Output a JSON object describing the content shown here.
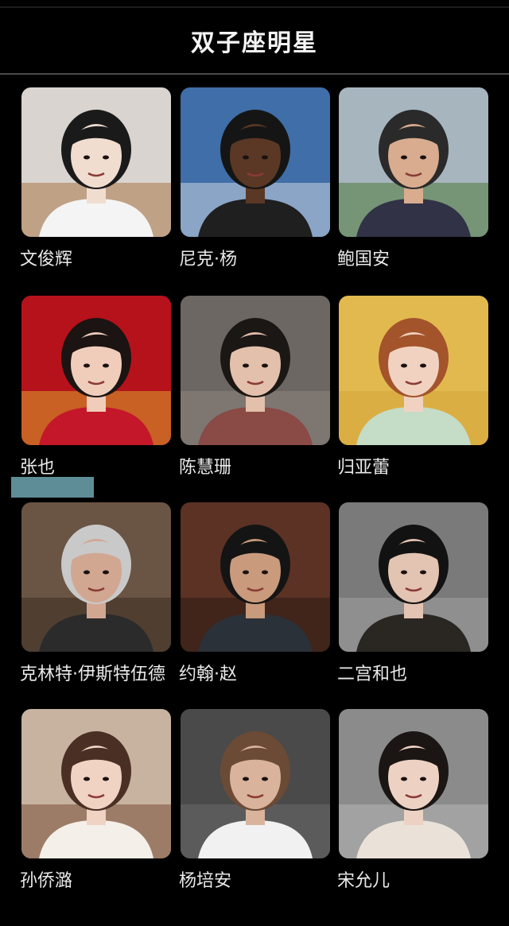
{
  "header": {
    "title": "双子座明星"
  },
  "celebrities": [
    {
      "name": "文俊辉",
      "bg": "#d9d4cf",
      "bg2": "#a9774a",
      "skin": "#f1ddd0",
      "hair": "#1a1a1a",
      "cloth": "#f4f4f4"
    },
    {
      "name": "尼克·杨",
      "bg": "#3f6ea8",
      "bg2": "#c9d3df",
      "skin": "#5a3825",
      "hair": "#151515",
      "cloth": "#1f1f1f"
    },
    {
      "name": "鲍国安",
      "bg": "#a7b5bf",
      "bg2": "#4f7a3d",
      "skin": "#d9ac8f",
      "hair": "#2a2a2a",
      "cloth": "#323246"
    },
    {
      "name": "张也",
      "bg": "#b6121b",
      "bg2": "#d9a12b",
      "skin": "#f0cdbb",
      "hair": "#1b1412",
      "cloth": "#c4172a"
    },
    {
      "name": "陈慧珊",
      "bg": "#6d6763",
      "bg2": "#8b847e",
      "skin": "#e3c0ab",
      "hair": "#1b1715",
      "cloth": "#8a4a45"
    },
    {
      "name": "归亚蕾",
      "bg": "#e2b94f",
      "bg2": "#d6a63b",
      "skin": "#f1d2c1",
      "hair": "#a3542b",
      "cloth": "#c5dcc7"
    },
    {
      "name": "克林特·伊斯特伍德",
      "bg": "#6a5443",
      "bg2": "#3b2c23",
      "skin": "#d1a792",
      "hair": "#c9c9c9",
      "cloth": "#2b2b2b"
    },
    {
      "name": "约翰·赵",
      "bg": "#5b3224",
      "bg2": "#2b1a13",
      "skin": "#c99a7c",
      "hair": "#141414",
      "cloth": "#2b3138"
    },
    {
      "name": "二宫和也",
      "bg": "#7a7a7a",
      "bg2": "#a0a0a0",
      "skin": "#e3c3b1",
      "hair": "#121212",
      "cloth": "#2a2723"
    },
    {
      "name": "孙侨潞",
      "bg": "#c7b39f",
      "bg2": "#7a4f38",
      "skin": "#f0d3c3",
      "hair": "#4a2f24",
      "cloth": "#f4efe9"
    },
    {
      "name": "杨培安",
      "bg": "#4a4a4a",
      "bg2": "#6a6a6a",
      "skin": "#d9b39c",
      "hair": "#6b4a36",
      "cloth": "#f1f1f1"
    },
    {
      "name": "宋允儿",
      "bg": "#8b8b8b",
      "bg2": "#b7b7b7",
      "skin": "#edd2c4",
      "hair": "#1b1513",
      "cloth": "#eae1d8"
    }
  ]
}
